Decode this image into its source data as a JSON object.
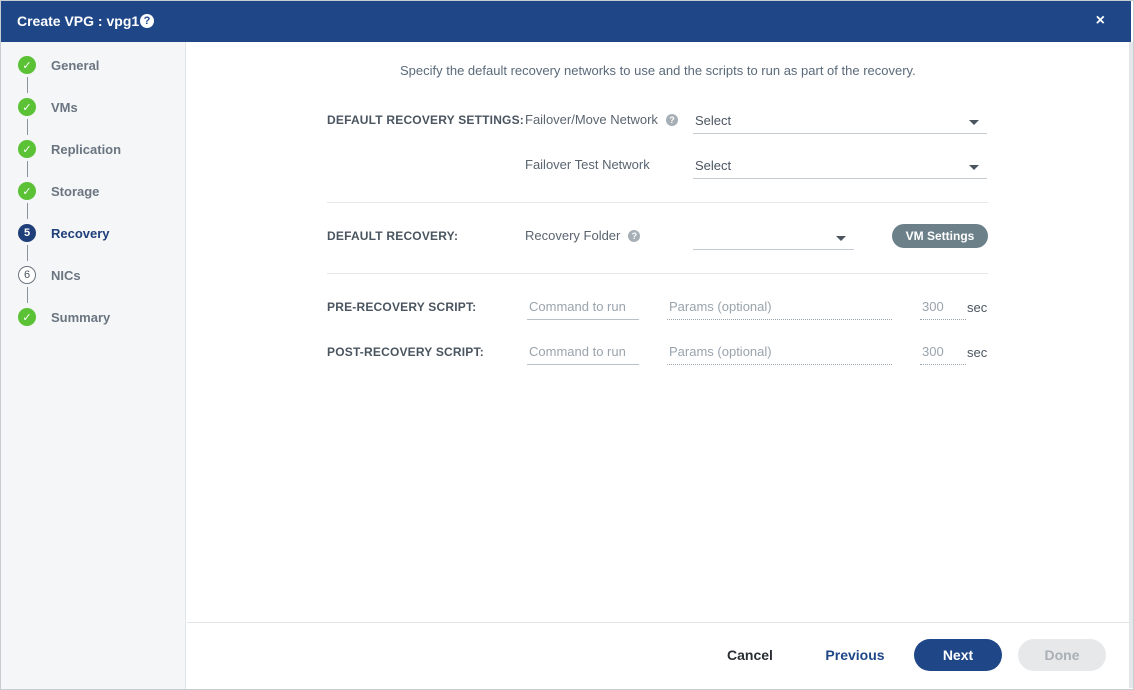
{
  "dialog": {
    "title": "Create VPG : vpg1",
    "help_glyph": "?",
    "close_glyph": "×"
  },
  "sidebar": {
    "steps": [
      {
        "label": "General",
        "state": "done",
        "icon": "check-icon"
      },
      {
        "label": "VMs",
        "state": "done",
        "icon": "check-icon"
      },
      {
        "label": "Replication",
        "state": "done",
        "icon": "check-icon"
      },
      {
        "label": "Storage",
        "state": "done",
        "icon": "check-icon"
      },
      {
        "label": "Recovery",
        "state": "current",
        "number": "5"
      },
      {
        "label": "NICs",
        "state": "todo",
        "number": "6"
      },
      {
        "label": "Summary",
        "state": "done",
        "icon": "check-icon"
      }
    ]
  },
  "main": {
    "intro": "Specify the default recovery networks to use and the scripts to run as part of the recovery.",
    "default_recovery_settings": {
      "label": "DEFAULT RECOVERY SETTINGS:",
      "failover_move_network": {
        "label": "Failover/Move Network",
        "value": "Select"
      },
      "failover_test_network": {
        "label": "Failover Test Network",
        "value": "Select"
      }
    },
    "default_recovery": {
      "label": "DEFAULT RECOVERY:",
      "recovery_folder": {
        "label": "Recovery Folder",
        "value": ""
      },
      "vm_settings_button": "VM Settings"
    },
    "pre_recovery_script": {
      "label": "PRE-RECOVERY SCRIPT:",
      "command_placeholder": "Command to run",
      "params_placeholder": "Params (optional)",
      "timeout": "300",
      "unit": "sec"
    },
    "post_recovery_script": {
      "label": "POST-RECOVERY SCRIPT:",
      "command_placeholder": "Command to run",
      "params_placeholder": "Params (optional)",
      "timeout": "300",
      "unit": "sec"
    }
  },
  "footer": {
    "cancel": "Cancel",
    "previous": "Previous",
    "next": "Next",
    "done": "Done"
  },
  "colors": {
    "header": "#1f4788",
    "step_done": "#5bc236",
    "step_current": "#1f3f7a",
    "primary_button": "#1f4788",
    "vm_settings_button": "#6c8089"
  }
}
